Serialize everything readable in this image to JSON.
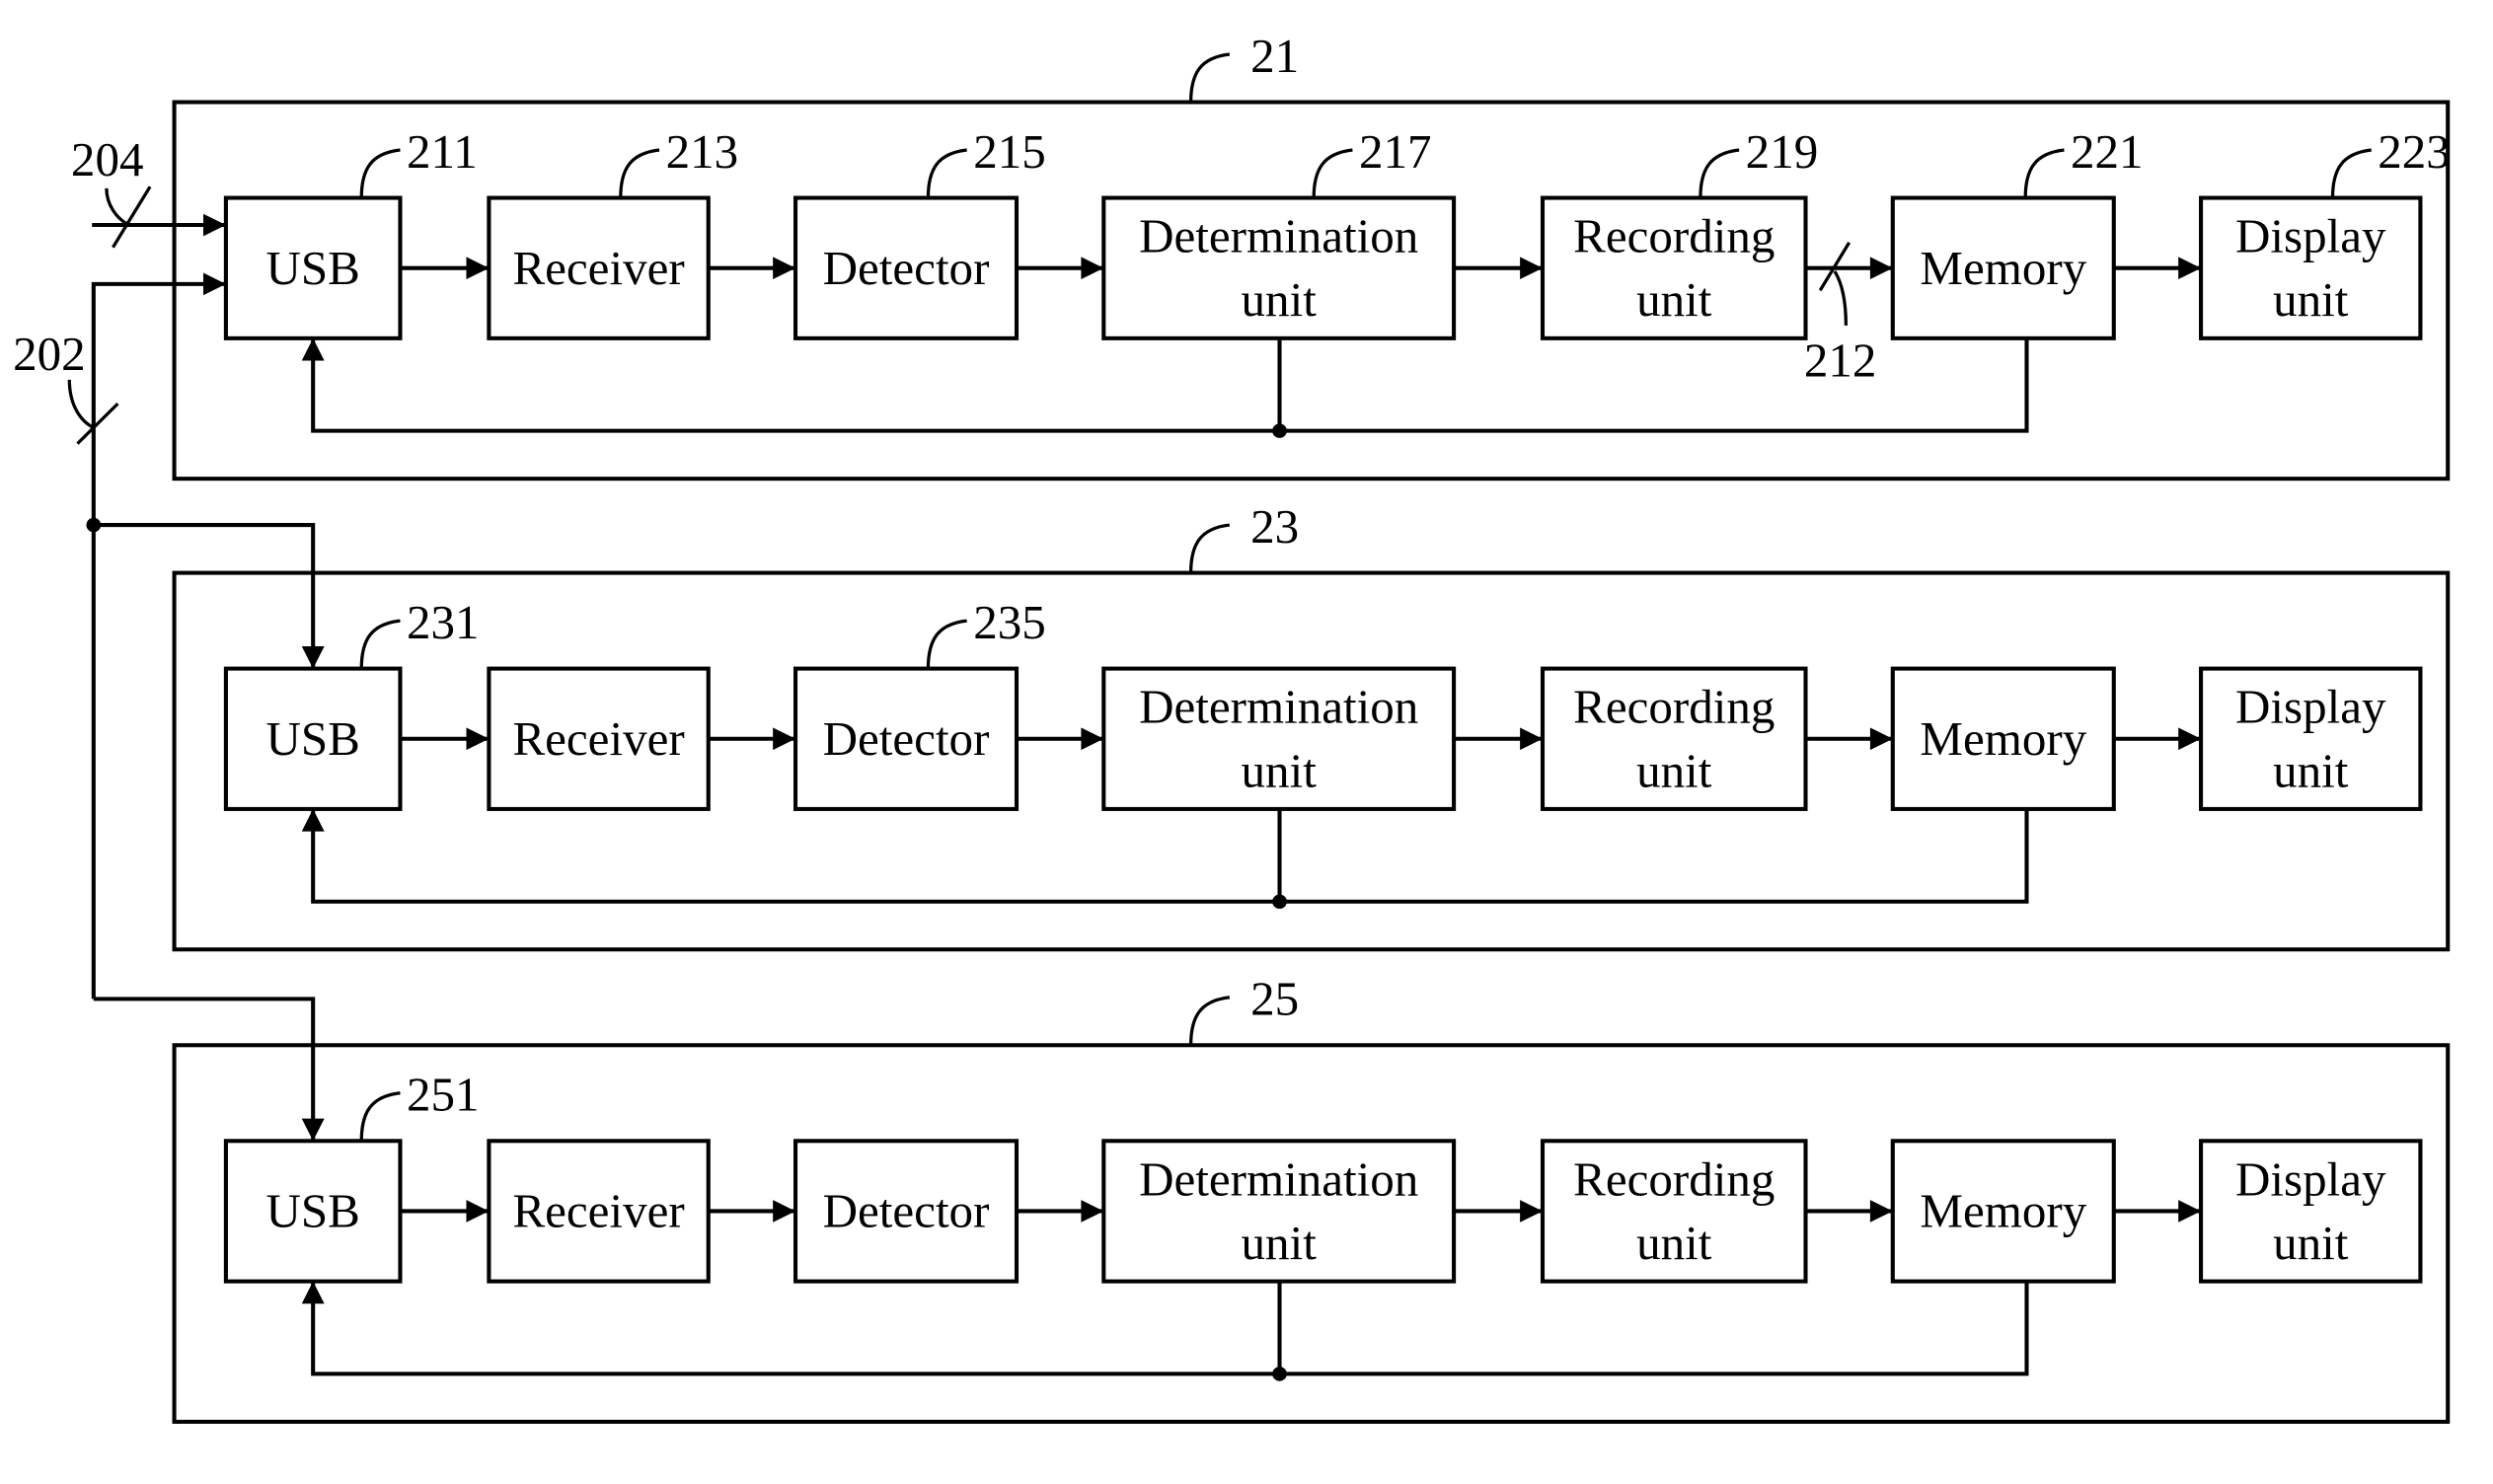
{
  "figure": {
    "colors": {
      "stroke": "#000000",
      "background": "#ffffff"
    },
    "external_refs": {
      "signal_204": "204",
      "signal_202": "202",
      "bus_212": "212"
    },
    "modules": [
      {
        "ref": "21",
        "blocks": [
          {
            "label": "USB",
            "ref": "211"
          },
          {
            "label": "Receiver",
            "ref": "213"
          },
          {
            "label": "Detector",
            "ref": "215"
          },
          {
            "label": "Determination unit",
            "line1": "Determination",
            "line2": "unit",
            "ref": "217"
          },
          {
            "label": "Recording unit",
            "line1": "Recording",
            "line2": "unit",
            "ref": "219"
          },
          {
            "label": "Memory",
            "ref": "221"
          },
          {
            "label": "Display unit",
            "line1": "Display",
            "line2": "unit",
            "ref": "223"
          }
        ]
      },
      {
        "ref": "23",
        "blocks": [
          {
            "label": "USB",
            "ref": "231"
          },
          {
            "label": "Receiver"
          },
          {
            "label": "Detector",
            "ref": "235"
          },
          {
            "label": "Determination unit",
            "line1": "Determination",
            "line2": "unit"
          },
          {
            "label": "Recording unit",
            "line1": "Recording",
            "line2": "unit"
          },
          {
            "label": "Memory"
          },
          {
            "label": "Display unit",
            "line1": "Display",
            "line2": "unit"
          }
        ]
      },
      {
        "ref": "25",
        "blocks": [
          {
            "label": "USB",
            "ref": "251"
          },
          {
            "label": "Receiver"
          },
          {
            "label": "Detector"
          },
          {
            "label": "Determination unit",
            "line1": "Determination",
            "line2": "unit"
          },
          {
            "label": "Recording unit",
            "line1": "Recording",
            "line2": "unit"
          },
          {
            "label": "Memory"
          },
          {
            "label": "Display unit",
            "line1": "Display",
            "line2": "unit"
          }
        ]
      }
    ]
  }
}
